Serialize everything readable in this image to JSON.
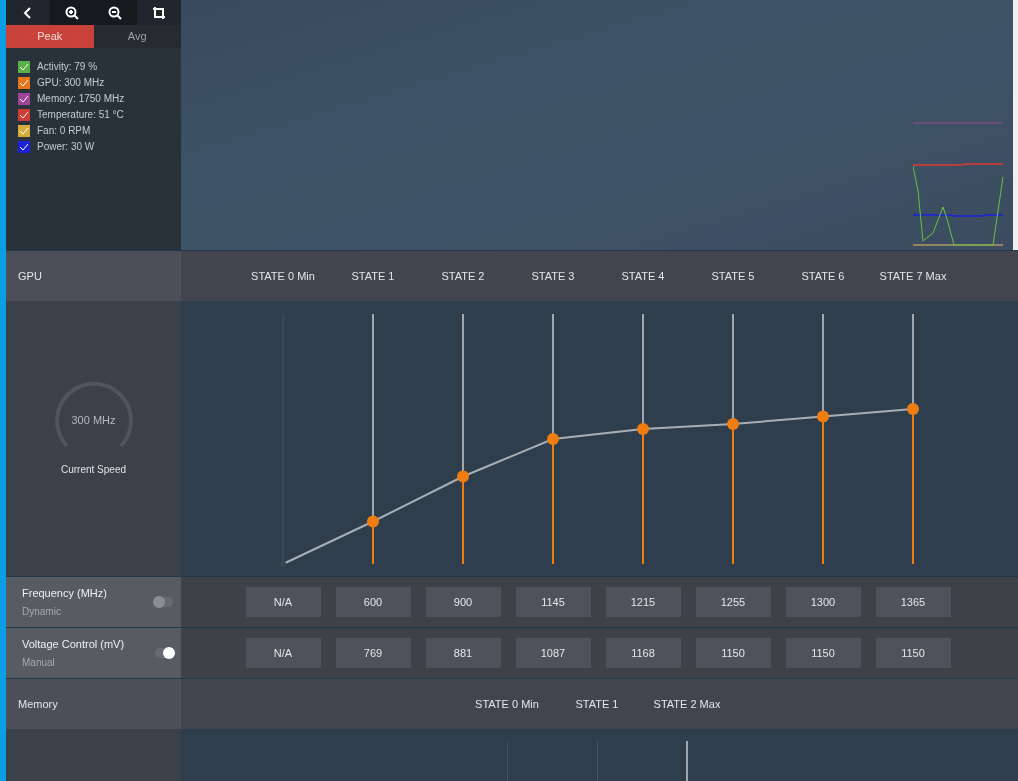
{
  "toolbar": {
    "buttons": [
      {
        "kind": "back"
      },
      {
        "kind": "zoom-in"
      },
      {
        "kind": "zoom-out"
      },
      {
        "kind": "reset"
      }
    ]
  },
  "tabs": [
    {
      "label": "Peak",
      "selected": true
    },
    {
      "label": "Avg",
      "selected": false
    }
  ],
  "legend": [
    {
      "label": "Activity: 79 %",
      "checked": true,
      "color": "#5ab048"
    },
    {
      "label": "GPU: 300 MHz",
      "checked": true,
      "color": "#e6761a"
    },
    {
      "label": "Memory: 1750 MHz",
      "checked": true,
      "color": "#a04596"
    },
    {
      "label": "Temperature: 51 °C",
      "checked": true,
      "color": "#d03c36"
    },
    {
      "label": "Fan: 0 RPM",
      "checked": true,
      "color": "#d7ac3c"
    },
    {
      "label": "Power: 30 W",
      "checked": true,
      "color": "#1a22d8"
    }
  ],
  "gpu": {
    "title": "GPU",
    "gauge": {
      "value": "300 MHz",
      "label": "Current Speed"
    },
    "states": [
      {
        "label": "STATE 0 Min",
        "disabled": true,
        "level": 0,
        "frequency": "N/A",
        "voltage": "N/A"
      },
      {
        "label": "STATE 1",
        "disabled": false,
        "level": 0.17,
        "frequency": "600",
        "voltage": "769"
      },
      {
        "label": "STATE 2",
        "disabled": false,
        "level": 0.35,
        "frequency": "900",
        "voltage": "881"
      },
      {
        "label": "STATE 3",
        "disabled": false,
        "level": 0.5,
        "frequency": "1145",
        "voltage": "1087"
      },
      {
        "label": "STATE 4",
        "disabled": false,
        "level": 0.54,
        "frequency": "1215",
        "voltage": "1168"
      },
      {
        "label": "STATE 5",
        "disabled": false,
        "level": 0.56,
        "frequency": "1255",
        "voltage": "1150"
      },
      {
        "label": "STATE 6",
        "disabled": false,
        "level": 0.59,
        "frequency": "1300",
        "voltage": "1150"
      },
      {
        "label": "STATE 7 Max",
        "disabled": false,
        "level": 0.62,
        "frequency": "1365",
        "voltage": "1150"
      }
    ],
    "frequency": {
      "label": "Frequency (MHz)",
      "mode": "Dynamic",
      "on": false
    },
    "voltage": {
      "label": "Voltage Control (mV)",
      "mode": "Manual",
      "on": true
    }
  },
  "memory": {
    "title": "Memory",
    "states": [
      {
        "label": "STATE 0 Min",
        "disabled": true
      },
      {
        "label": "STATE 1",
        "disabled": true
      },
      {
        "label": "STATE 2 Max",
        "disabled": false
      }
    ]
  }
}
